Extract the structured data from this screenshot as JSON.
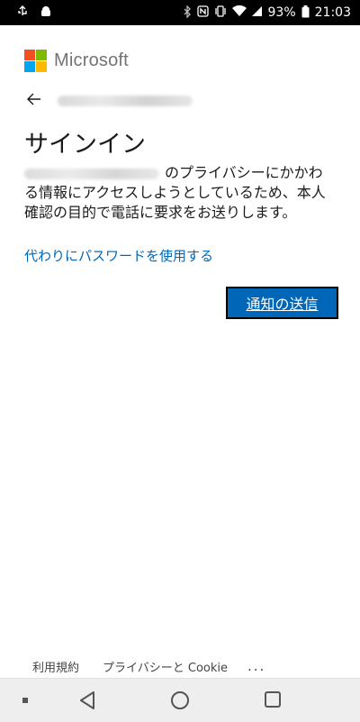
{
  "status_bar": {
    "battery_percent": "93%",
    "time": "21:03",
    "icons": [
      "usb-icon",
      "android-debug-icon",
      "bluetooth-icon",
      "nfc-icon",
      "vibrate-icon",
      "wifi-icon",
      "signal-icon",
      "battery-icon"
    ]
  },
  "brand": {
    "name": "Microsoft",
    "colors": {
      "red": "#f25022",
      "green": "#7fba00",
      "blue": "#00a4ef",
      "yellow": "#ffb900"
    }
  },
  "signin": {
    "title": "サインイン",
    "description": "のプライバシーにかかわる情報にアクセスしようとしているため、本人確認の目的で電話に要求をお送りします。",
    "use_password_link": "代わりにパスワードを使用する",
    "send_button": "通知の送信"
  },
  "footer": {
    "terms": "利用規約",
    "privacy": "プライバシーと Cookie",
    "more": "..."
  },
  "colors": {
    "accent": "#0067b8",
    "text": "#1b1b1b"
  }
}
